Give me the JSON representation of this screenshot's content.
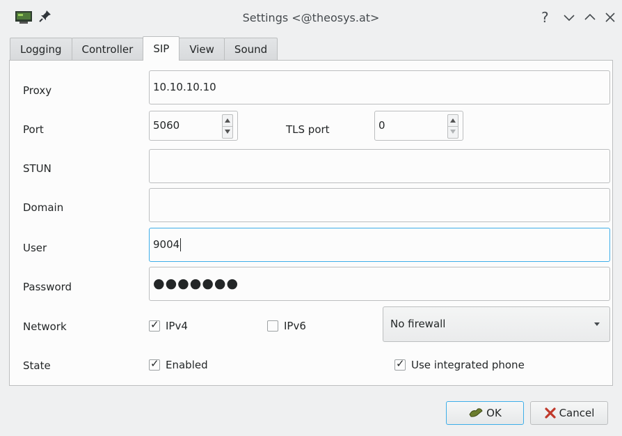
{
  "window": {
    "title": "Settings <@theosys.at>",
    "icons": [
      "app-icon",
      "pin-icon",
      "help-icon",
      "minimize-icon",
      "maximize-icon",
      "close-icon"
    ],
    "help_glyph": "?"
  },
  "tabs": [
    {
      "label": "Logging",
      "active": false
    },
    {
      "label": "Controller",
      "active": false
    },
    {
      "label": "SIP",
      "active": true
    },
    {
      "label": "View",
      "active": false
    },
    {
      "label": "Sound",
      "active": false
    }
  ],
  "form": {
    "proxy_label": "Proxy",
    "proxy_value": "10.10.10.10",
    "port_label": "Port",
    "port_value": "5060",
    "tls_port_label": "TLS port",
    "tls_port_value": "0",
    "stun_label": "STUN",
    "stun_value": "",
    "domain_label": "Domain",
    "domain_value": "",
    "user_label": "User",
    "user_value": "9004",
    "password_label": "Password",
    "password_value": "●●●●●●●",
    "network_label": "Network",
    "ipv4_label": "IPv4",
    "ipv4_checked": true,
    "ipv6_label": "IPv6",
    "ipv6_checked": false,
    "firewall_value": "No firewall",
    "state_label": "State",
    "enabled_label": "Enabled",
    "enabled_checked": true,
    "integrated_phone_label": "Use integrated phone",
    "integrated_phone_checked": true
  },
  "buttons": {
    "ok_label": "OK",
    "cancel_label": "Cancel"
  },
  "colors": {
    "focus": "#3daee9",
    "background": "#eff0f1",
    "cancel_icon": "#c0392b"
  }
}
